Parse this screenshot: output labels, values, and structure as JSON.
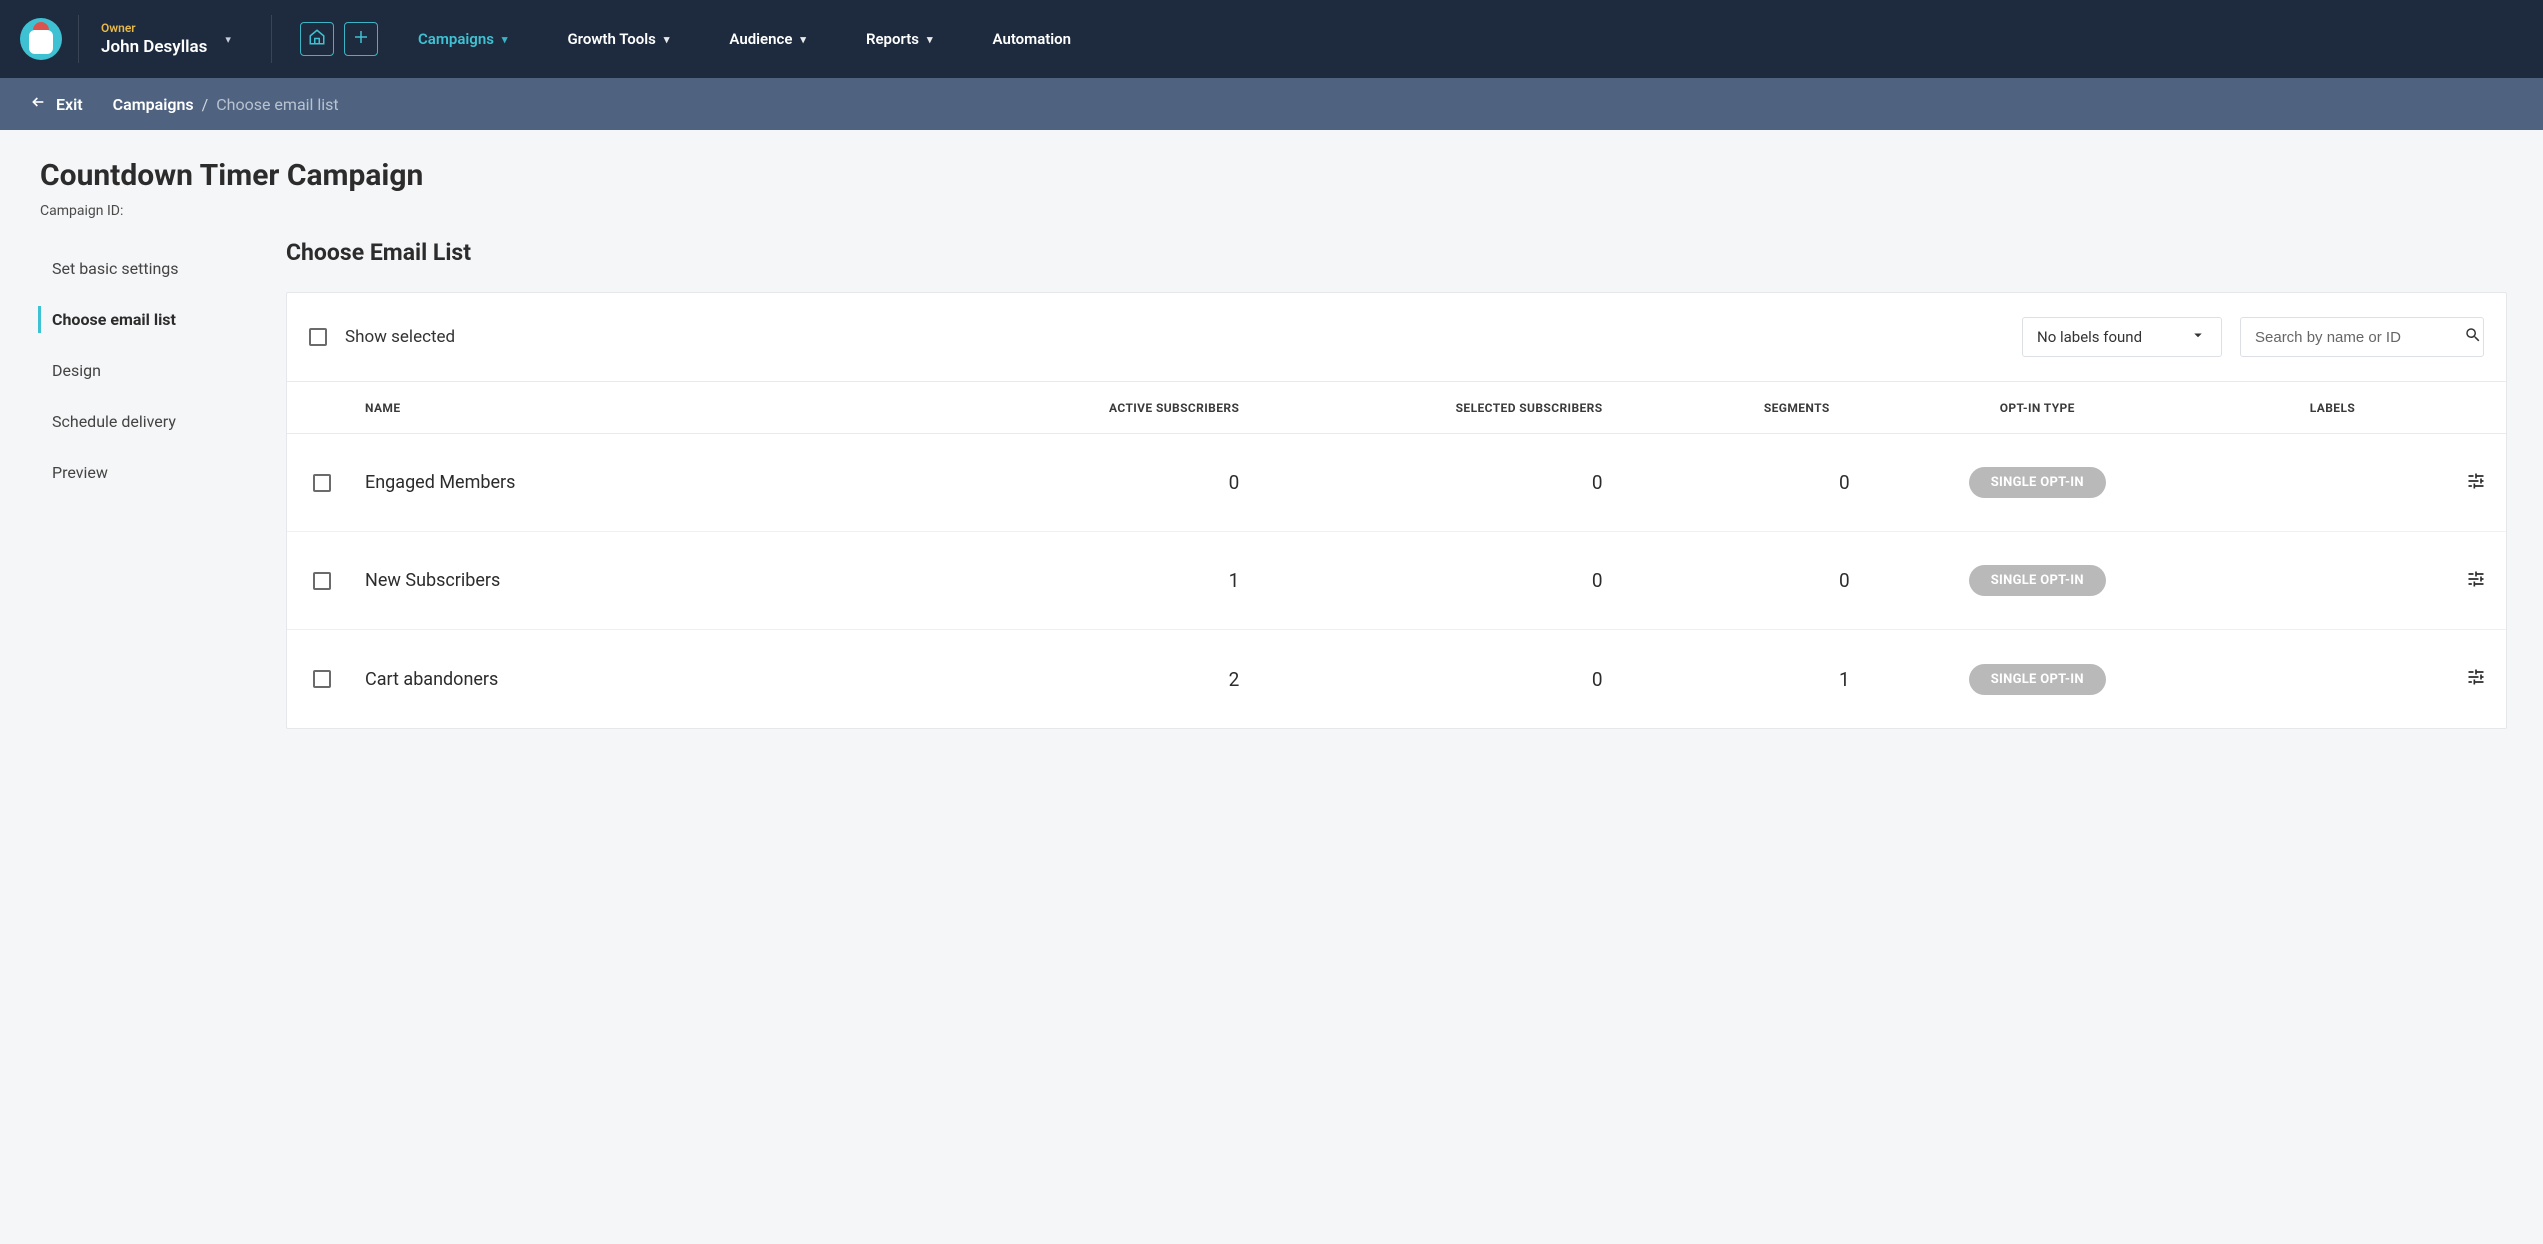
{
  "account": {
    "role_label": "Owner",
    "name": "John Desyllas"
  },
  "topnav": {
    "items": [
      {
        "label": "Campaigns",
        "dropdown": true,
        "active": true
      },
      {
        "label": "Growth Tools",
        "dropdown": true,
        "active": false
      },
      {
        "label": "Audience",
        "dropdown": true,
        "active": false
      },
      {
        "label": "Reports",
        "dropdown": true,
        "active": false
      },
      {
        "label": "Automation",
        "dropdown": false,
        "active": false
      }
    ]
  },
  "subbar": {
    "exit_label": "Exit",
    "crumb_root": "Campaigns",
    "crumb_here": "Choose email list"
  },
  "page": {
    "title": "Countdown Timer Campaign",
    "campaign_id_label": "Campaign ID:",
    "section_title": "Choose Email List"
  },
  "steps": [
    {
      "label": "Set basic settings",
      "active": false
    },
    {
      "label": "Choose email list",
      "active": true
    },
    {
      "label": "Design",
      "active": false
    },
    {
      "label": "Schedule delivery",
      "active": false
    },
    {
      "label": "Preview",
      "active": false
    }
  ],
  "toolbar": {
    "show_selected_label": "Show selected",
    "labels_select_text": "No labels found",
    "search_placeholder": "Search by name or ID"
  },
  "table": {
    "headers": {
      "name": "NAME",
      "active": "ACTIVE SUBSCRIBERS",
      "selected": "SELECTED SUBSCRIBERS",
      "segments": "SEGMENTS",
      "optin": "OPT-IN TYPE",
      "labels": "LABELS"
    },
    "rows": [
      {
        "name": "Engaged Members",
        "active": "0",
        "selected": "0",
        "segments": "0",
        "optin": "SINGLE OPT-IN"
      },
      {
        "name": "New Subscribers",
        "active": "1",
        "selected": "0",
        "segments": "0",
        "optin": "SINGLE OPT-IN"
      },
      {
        "name": "Cart abandoners",
        "active": "2",
        "selected": "0",
        "segments": "1",
        "optin": "SINGLE OPT-IN"
      }
    ]
  }
}
